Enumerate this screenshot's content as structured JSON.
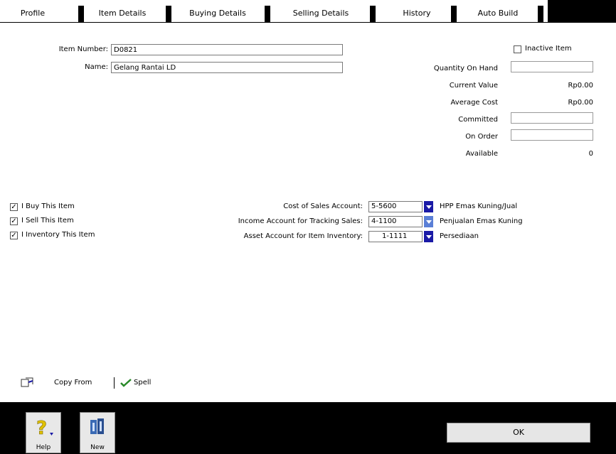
{
  "tabs": [
    "Profile",
    "Item Details",
    "Buying Details",
    "Selling Details",
    "History",
    "Auto Build"
  ],
  "item": {
    "number_label": "Item Number:",
    "number_value": "D0821",
    "name_label": "Name:",
    "name_value": "Gelang Rantai LD",
    "inactive_label": "Inactive Item"
  },
  "stock": {
    "quantity_label": "Quantity On Hand",
    "current_value_label": "Current Value",
    "current_value": "Rp0.00",
    "average_cost_label": "Average Cost",
    "average_cost": "Rp0.00",
    "committed_label": "Committed",
    "on_order_label": "On Order",
    "available_label": "Available",
    "available_value": "0"
  },
  "checks": {
    "buy": "I Buy This Item",
    "sell": "I Sell This Item",
    "inventory": "I Inventory This Item"
  },
  "accounts": {
    "cogs_label": "Cost of Sales Account:",
    "cogs_code": "5-5600",
    "cogs_name": "HPP Emas Kuning/Jual",
    "income_label": "Income Account for Tracking Sales:",
    "income_code": "4-1100",
    "income_name": "Penjualan Emas Kuning",
    "asset_label": "Asset Account for Item Inventory:",
    "asset_code": "1-1111",
    "asset_name": "Persediaan"
  },
  "footer": {
    "copy_from": "Copy From",
    "spell": "Spell",
    "help": "Help",
    "new": "New",
    "ok": "OK"
  },
  "colors": {
    "dropdown": "#1a1aa6",
    "bottom_bar": "#000000"
  }
}
